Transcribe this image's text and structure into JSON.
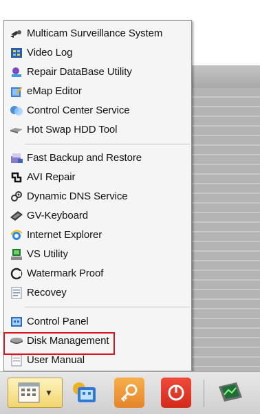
{
  "menu": {
    "items": [
      {
        "label": "Multicam Surveillance System",
        "icon": "multicam-icon"
      },
      {
        "label": "Video Log",
        "icon": "video-log-icon"
      },
      {
        "label": "Repair DataBase Utility",
        "icon": "repair-database-icon"
      },
      {
        "label": "eMap Editor",
        "icon": "emap-editor-icon"
      },
      {
        "label": "Control Center Service",
        "icon": "control-center-icon"
      },
      {
        "label": "Hot Swap HDD Tool",
        "icon": "hot-swap-hdd-icon"
      },
      {
        "label": "Fast Backup and Restore",
        "icon": "fast-backup-icon"
      },
      {
        "label": "AVI Repair",
        "icon": "avi-repair-icon"
      },
      {
        "label": "Dynamic DNS Service",
        "icon": "dynamic-dns-icon"
      },
      {
        "label": "GV-Keyboard",
        "icon": "gv-keyboard-icon"
      },
      {
        "label": "Internet Explorer",
        "icon": "internet-explorer-icon"
      },
      {
        "label": "VS Utility",
        "icon": "vs-utility-icon"
      },
      {
        "label": "Watermark Proof",
        "icon": "watermark-proof-icon"
      },
      {
        "label": "Recovey",
        "icon": "recovery-icon"
      },
      {
        "label": "Control Panel",
        "icon": "control-panel-icon"
      },
      {
        "label": "Disk Management",
        "icon": "disk-management-icon"
      },
      {
        "label": "User Manual",
        "icon": "user-manual-icon"
      }
    ],
    "highlighted_item": "Disk Management"
  },
  "taskbar": {
    "buttons": [
      "start-menu-icon",
      "dropdown-arrow-icon",
      "network-icon",
      "key-icon",
      "power-icon",
      "monitor-icon"
    ]
  },
  "colors": {
    "highlight": "#d9131c",
    "menu_bg": "#f5f5f5",
    "taskbar": "#dcdcdc"
  }
}
